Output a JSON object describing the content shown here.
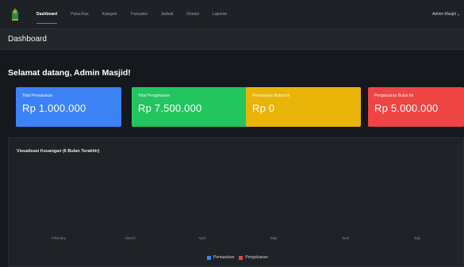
{
  "navbar": {
    "items": [
      {
        "label": "Dashboard",
        "active": true
      },
      {
        "label": "Pulsa Kas"
      },
      {
        "label": "Kategori"
      },
      {
        "label": "Transaksi"
      },
      {
        "label": "Jadwal"
      },
      {
        "label": "Donasi"
      },
      {
        "label": "Laporan"
      }
    ],
    "user_label": "Admin Masjid"
  },
  "header": {
    "title": "Dashboard"
  },
  "welcome": "Selamat datang, Admin Masjid!",
  "cards": [
    {
      "label": "Total Pemasukan",
      "value": "Rp 1.000.000",
      "color": "#3b82f6"
    },
    {
      "label": "Total Pengeluaran",
      "value": "Rp 7.500.000",
      "color": "#22c55e"
    },
    {
      "label": "Pemasukan Bulan Ini",
      "value": "Rp 0",
      "color": "#eab308"
    },
    {
      "label": "Pengeluaran Bulan Ini",
      "value": "Rp 5.000.000",
      "color": "#ef4444"
    }
  ],
  "chart_data": {
    "type": "bar",
    "title": "Visualisasi Keuangan (6 Bulan Terakhir)",
    "categories": [
      "February",
      "March",
      "April",
      "May",
      "June",
      "July"
    ],
    "series": [
      {
        "name": "Pemasukan",
        "color": "#3b82f6",
        "values": [
          0,
          0,
          0,
          0,
          0,
          0
        ]
      },
      {
        "name": "Pengeluaran",
        "color": "#ef4444",
        "values": [
          0,
          0,
          0,
          0,
          0,
          0
        ]
      }
    ],
    "grid": false,
    "legend": "bottom-center"
  }
}
